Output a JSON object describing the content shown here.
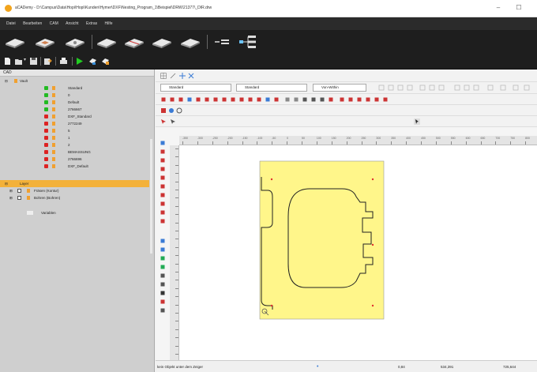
{
  "window": {
    "title": "aCADemy - D:\\Campus\\Data\\Hopi\\Hopi\\Kunden\\Hymer\\DXF\\Nesting_Program_1\\Beispiel\\DRW\\21377\\_DIR.drw",
    "minimize_glyph": "–",
    "maximize_glyph": "☐"
  },
  "menu": [
    "Datei",
    "Bearbeiten",
    "CAM",
    "Ansicht",
    "Extras",
    "Hilfe"
  ],
  "colors": {
    "layer_highlight": "#f3b13a",
    "part_fill": "#fff68a",
    "contour": "#222222",
    "marker": "#e03030",
    "green_status": "#22bb22",
    "red_status": "#dd2222"
  },
  "tree": {
    "header": "CAD",
    "root_label": "Vault",
    "items": [
      {
        "label": "Standard",
        "status": "green"
      },
      {
        "label": "0",
        "status": "green"
      },
      {
        "label": "Default",
        "status": "green"
      },
      {
        "label": "2766667",
        "status": "green"
      },
      {
        "label": "DXF_Standard",
        "status": "red"
      },
      {
        "label": "2772249",
        "status": "red"
      },
      {
        "label": "5",
        "status": "red"
      },
      {
        "label": "1",
        "status": "red"
      },
      {
        "label": "2",
        "status": "red"
      },
      {
        "label": "BEMASSUNG",
        "status": "red"
      },
      {
        "label": "2766696",
        "status": "red"
      },
      {
        "label": "DXF_Default",
        "status": "red"
      }
    ],
    "layer_section": "Layer",
    "layer_items": [
      "Fräsen (Kontur)",
      "Bohren (Bohren)"
    ],
    "variables_label": "Variablen"
  },
  "toolbars": {
    "combo_standard": "Standard",
    "combo_style": "Standard",
    "combo_linetype": "Von-Within"
  },
  "status": {
    "hint": "kein Objekt unter dem Zeiger",
    "value1": "0,84",
    "value2": "534,391",
    "value3": "725,644"
  },
  "ruler_ticks": [
    "-350",
    "-300",
    "-250",
    "-200",
    "-150",
    "-100",
    "-50",
    "0",
    "50",
    "100",
    "150",
    "200",
    "250",
    "300",
    "350",
    "400",
    "450",
    "500",
    "550",
    "600",
    "650",
    "700",
    "750",
    "800"
  ]
}
